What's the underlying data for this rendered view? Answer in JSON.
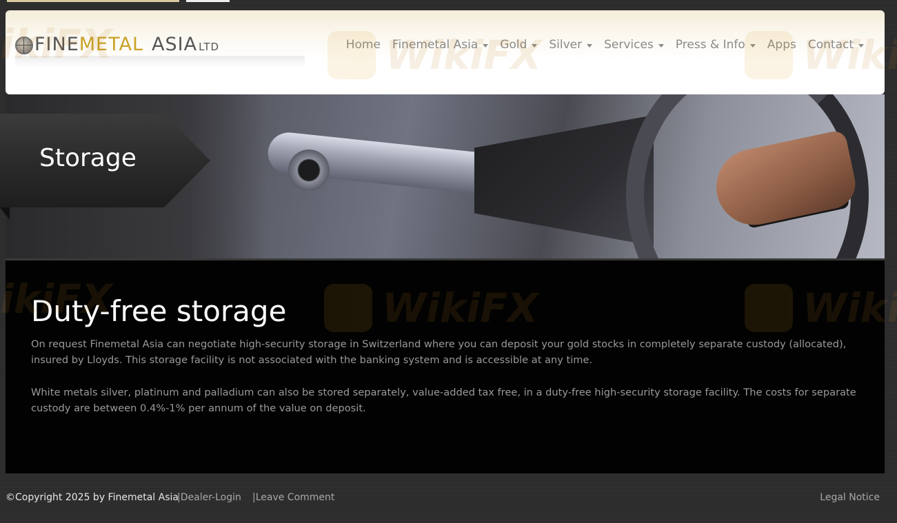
{
  "header": {
    "logo": {
      "part1": "FINE",
      "part2": "METAL",
      "part3": "ASIA",
      "part4": "LTD"
    },
    "nav": [
      {
        "label": "Home",
        "has_dropdown": false
      },
      {
        "label": "Finemetal Asia",
        "has_dropdown": true
      },
      {
        "label": "Gold",
        "has_dropdown": true
      },
      {
        "label": "Silver",
        "has_dropdown": true
      },
      {
        "label": "Services",
        "has_dropdown": true
      },
      {
        "label": "Press & Info",
        "has_dropdown": true
      },
      {
        "label": "Apps",
        "has_dropdown": false
      },
      {
        "label": "Contact",
        "has_dropdown": true
      }
    ]
  },
  "banner": {
    "page_title": "Storage"
  },
  "content": {
    "heading": "Duty-free storage",
    "paragraph1": "On request Finemetal Asia can negotiate high-security storage in Switzerland where you can deposit your gold stocks in completely separate custody (allocated), insured by Lloyds. This storage facility is not associated with the banking system and is accessible at any time.",
    "paragraph2": "White metals silver, platinum and palladium can also be stored separately, value-added tax free, in a duty-free high-security storage facility. The costs for separate custody are between 0.4%-1% per annum of the value on deposit."
  },
  "footer": {
    "copyright": "©Copyright 2025 by Finemetal Asia",
    "dealer_login": "|Dealer-Login",
    "leave_comment": "|Leave Comment",
    "legal_notice": "Legal Notice"
  },
  "watermark": {
    "text": "WikiFX"
  },
  "colors": {
    "accent_gold": "#c9a227",
    "nav_text": "#8a8a8a",
    "content_bg": "#020202",
    "page_bg": "#2b2b2b"
  }
}
